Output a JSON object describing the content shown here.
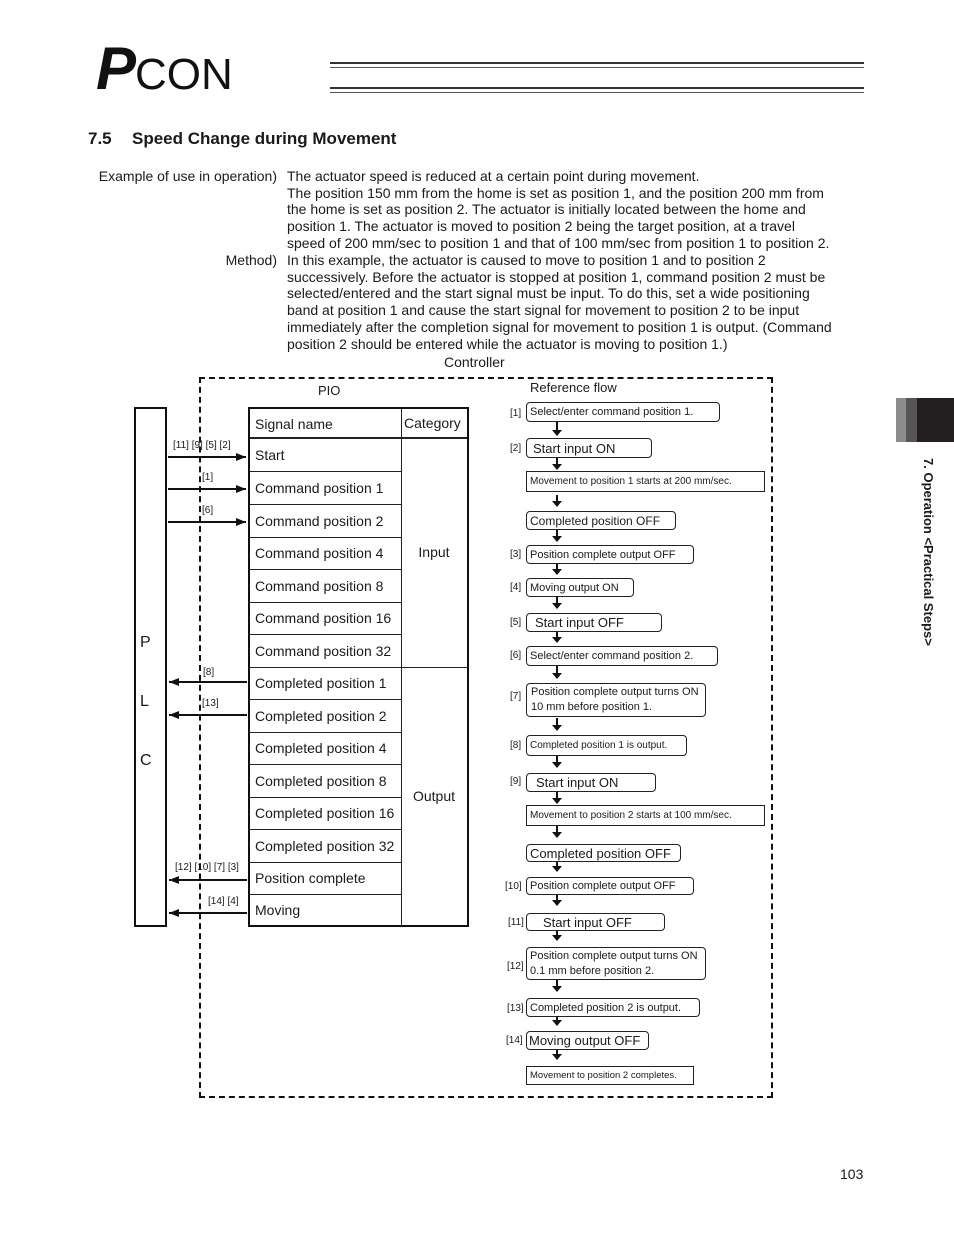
{
  "header": {
    "logo_p": "P",
    "logo_rest": "CON"
  },
  "section": {
    "number": "7.5",
    "title": "Speed Change during Movement"
  },
  "example": {
    "label": "Example of use in operation)",
    "lines": [
      "The actuator speed is reduced at a certain point during movement.",
      "The position 150 mm from the home is set as position 1, and the position 200 mm from",
      "the home is set as position 2. The actuator is initially located between the home and",
      "position 1. The actuator is moved to position 2 being the target position, at a travel",
      "speed of 200 mm/sec to position 1 and that of 100 mm/sec from position 1 to position 2."
    ]
  },
  "method": {
    "label": "Method)",
    "lines": [
      "In this example, the actuator is caused to move to position 1 and to position 2",
      "successively. Before the actuator is stopped at position 1, command position 2 must be",
      "selected/entered and the start signal must be input. To do this, set a wide positioning",
      "band at position 1 and cause the start signal for movement to position 2 to be input",
      "immediately after the completion signal for movement to position 1 is output. (Command",
      "position 2 should be entered while the actuator is moving to position 1.)"
    ]
  },
  "diagram": {
    "controller_label": "Controller",
    "pio_label": "PIO",
    "plc_letters": [
      "P",
      "L",
      "C"
    ],
    "table": {
      "col_signal": "Signal name",
      "col_category": "Category",
      "rows": [
        "Start",
        "Command position 1",
        "Command position 2",
        "Command position 4",
        "Command position 8",
        "Command position 16",
        "Command position 32",
        "Completed position 1",
        "Completed position 2",
        "Completed position 4",
        "Completed position 8",
        "Completed position 16",
        "Completed position 32",
        "Position complete",
        "Moving"
      ],
      "category_input": "Input",
      "category_output": "Output"
    },
    "signal_arrows": [
      {
        "label": "[11] [9] [5] [2]",
        "direction": "to-controller",
        "row": "Start"
      },
      {
        "label": "[1]",
        "direction": "to-controller",
        "row": "Command position 1"
      },
      {
        "label": "[6]",
        "direction": "to-controller",
        "row": "Command position 2"
      },
      {
        "label": "[8]",
        "direction": "to-plc",
        "row": "Completed position 1"
      },
      {
        "label": "[13]",
        "direction": "to-plc",
        "row": "Completed position 2"
      },
      {
        "label": "[12] [10] [7] [3]",
        "direction": "to-plc",
        "row": "Position complete"
      },
      {
        "label": "[14] [4]",
        "direction": "to-plc",
        "row": "Moving"
      }
    ],
    "reference_flow": {
      "title": "Reference flow",
      "steps": [
        {
          "step": "[1]",
          "text": "Select/enter command position 1."
        },
        {
          "step": "[2]",
          "text": "Start input ON"
        },
        {
          "step": "",
          "text": "Movement to position 1 starts at 200 mm/sec."
        },
        {
          "step": "",
          "text": "Completed position OFF"
        },
        {
          "step": "[3]",
          "text": "Position complete output OFF"
        },
        {
          "step": "[4]",
          "text": "Moving output ON"
        },
        {
          "step": "[5]",
          "text": "Start input OFF"
        },
        {
          "step": "[6]",
          "text": "Select/enter command position 2."
        },
        {
          "step": "[7]",
          "text": "Position complete output turns ON 10 mm before position 1."
        },
        {
          "step": "[8]",
          "text": "Completed position 1 is output."
        },
        {
          "step": "[9]",
          "text": "Start input ON"
        },
        {
          "step": "",
          "text": "Movement to position 2 starts at 100 mm/sec."
        },
        {
          "step": "",
          "text": "Completed position OFF"
        },
        {
          "step": "[10]",
          "text": "Position complete output OFF"
        },
        {
          "step": "[11]",
          "text": "Start input OFF"
        },
        {
          "step": "[12]",
          "text": "Position complete output turns ON 0.1 mm before position 2."
        },
        {
          "step": "[13]",
          "text": "Completed position 2 is output."
        },
        {
          "step": "[14]",
          "text": "Moving output OFF"
        },
        {
          "step": "",
          "text": "Movement to position 2 completes."
        }
      ]
    }
  },
  "side_tab": {
    "label": "7. Operation <Practical Steps>"
  },
  "footer": {
    "page_number": "103"
  }
}
